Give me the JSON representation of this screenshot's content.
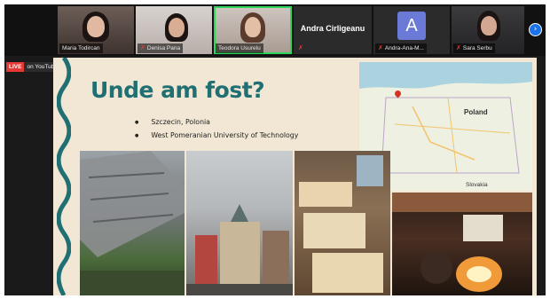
{
  "participants": [
    {
      "name": "Maria Todircan",
      "muted": false
    },
    {
      "name": "Denisa Pana",
      "muted": true
    },
    {
      "name": "Teodora Usurelu",
      "muted": false
    },
    {
      "name": "Andra Cirligeanu",
      "muted": true
    },
    {
      "name": "Andra-Ana-M...",
      "muted": true,
      "avatar_letter": "A"
    },
    {
      "name": "Sara Serbu",
      "muted": true
    }
  ],
  "live_badge": {
    "live": "LIVE",
    "platform": "on YouTube"
  },
  "next_button_icon": "chevron-right-icon",
  "slide": {
    "title": "Unde am fost?",
    "bullets": [
      "Szczecin, Polonia",
      "West Pomeranian University of Technology"
    ],
    "map_labels": {
      "country": "Poland",
      "neighbor": "Slovakia"
    }
  },
  "colors": {
    "title": "#1f6f73",
    "slide_bg": "#f1e7d4",
    "active_speaker": "#2bd65a",
    "live": "#e53935",
    "avatar": "#6b7ad6"
  }
}
